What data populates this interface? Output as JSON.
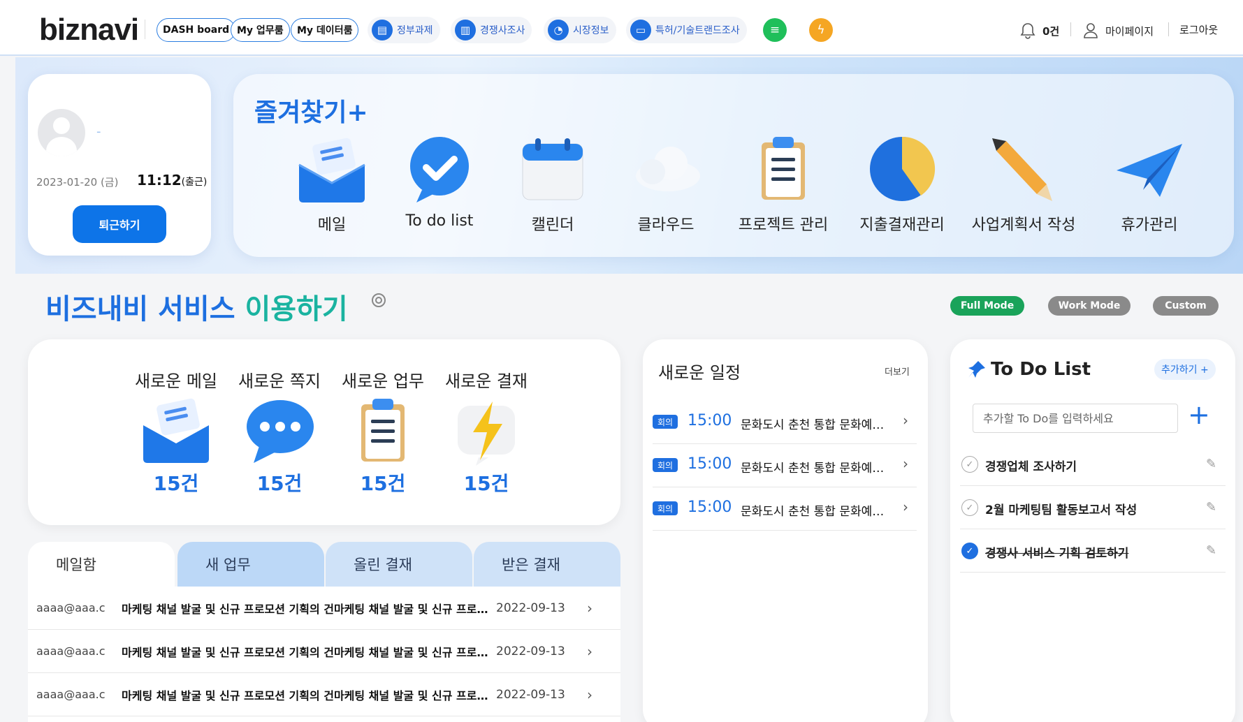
{
  "header": {
    "logo": "biznavi",
    "pills": [
      "DASH board",
      "My 업무룸",
      "My 데이터룸"
    ],
    "menu": [
      {
        "label": "정부과제",
        "icon": "document-icon"
      },
      {
        "label": "경쟁사조사",
        "icon": "building-icon"
      },
      {
        "label": "시장정보",
        "icon": "pie-chart-icon"
      },
      {
        "label": "특허/기술트랜드조사",
        "icon": "folder-icon"
      }
    ],
    "extra_icons": [
      "database-icon",
      "lightning-icon"
    ],
    "notification_count": "0건",
    "mypage": "마이페이지",
    "logout": "로그아웃"
  },
  "profile": {
    "name": "-",
    "date": "2023-01-20 (금)",
    "time": "11:12",
    "time_status": "(출근)",
    "leave_button": "퇴근하기"
  },
  "favorites": {
    "title": "즐겨찾기+",
    "items": [
      {
        "label": "메일",
        "icon": "mail-icon"
      },
      {
        "label": "To do list",
        "icon": "check-bubble-icon"
      },
      {
        "label": "캘린더",
        "icon": "calendar-icon"
      },
      {
        "label": "클라우드",
        "icon": "cloud-icon"
      },
      {
        "label": "프로젝트 관리",
        "icon": "clipboard-icon"
      },
      {
        "label": "지출결재관리",
        "icon": "pie-chart-icon"
      },
      {
        "label": "사업계획서 작성",
        "icon": "pencil-icon"
      },
      {
        "label": "휴가관리",
        "icon": "paper-plane-icon"
      }
    ]
  },
  "service": {
    "title_main": "비즈내비 서비스 ",
    "title_accent": "이용하기",
    "modes": [
      {
        "label": "Full Mode",
        "color": "#1aa35a"
      },
      {
        "label": "Work Mode",
        "color": "#8a8a8a"
      },
      {
        "label": "Custom",
        "color": "#8a8a8a"
      }
    ]
  },
  "stats": [
    {
      "label": "새로운 메일",
      "count": "15건",
      "icon": "mail-icon"
    },
    {
      "label": "새로운 쪽지",
      "count": "15건",
      "icon": "chat-bubble-icon"
    },
    {
      "label": "새로운 업무",
      "count": "15건",
      "icon": "clipboard-icon"
    },
    {
      "label": "새로운 결재",
      "count": "15건",
      "icon": "lightning-icon"
    }
  ],
  "mail_tabs": [
    "메일함",
    "새 업무",
    "올린 결재",
    "받은 결재"
  ],
  "mails": [
    {
      "from": "aaaa@aaa.c",
      "subject": "마케팅 채널 발굴 및 신규 프로모션 기획의 건마케팅 채널 발굴 및 신규 프로모션",
      "date": "2022-09-13"
    },
    {
      "from": "aaaa@aaa.c",
      "subject": "마케팅 채널 발굴 및 신규 프로모션 기획의 건마케팅 채널 발굴 및 신규 프로모션",
      "date": "2022-09-13"
    },
    {
      "from": "aaaa@aaa.c",
      "subject": "마케팅 채널 발굴 및 신규 프로모션 기획의 건마케팅 채널 발굴 및 신규 프로모션",
      "date": "2022-09-13"
    }
  ],
  "schedule": {
    "title": "새로운 일정",
    "more": "더보기",
    "items": [
      {
        "badge": "회의",
        "time": "15:00",
        "text": "문화도시 춘천 통합 문화예술 행사"
      },
      {
        "badge": "회의",
        "time": "15:00",
        "text": "문화도시 춘천 통합 문화예술 행사"
      },
      {
        "badge": "회의",
        "time": "15:00",
        "text": "문화도시 춘천 통합 문화예술 행사"
      }
    ]
  },
  "todo": {
    "title": "To Do List",
    "add_label": "추가하기 +",
    "placeholder": "추가할 To Do를 입력하세요",
    "items": [
      {
        "text": "경쟁업체 조사하기",
        "done": false
      },
      {
        "text": "2월 마케팅팀 활동보고서 작성",
        "done": false
      },
      {
        "text": "경쟁사 서비스 기획 검토하기",
        "done": true
      }
    ]
  }
}
